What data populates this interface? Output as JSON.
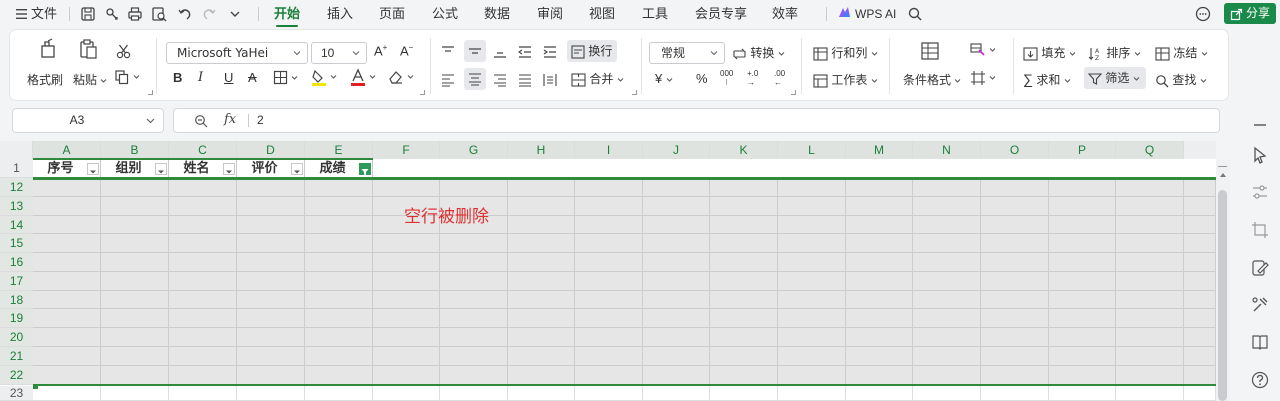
{
  "menubar": {
    "file_label": "文件",
    "tabs": [
      {
        "label": "开始",
        "active": true
      },
      {
        "label": "插入"
      },
      {
        "label": "页面"
      },
      {
        "label": "公式"
      },
      {
        "label": "数据"
      },
      {
        "label": "审阅"
      },
      {
        "label": "视图"
      },
      {
        "label": "工具"
      },
      {
        "label": "会员专享"
      },
      {
        "label": "效率"
      }
    ],
    "ai_label": "WPS AI",
    "share_label": "分享",
    "icons": [
      "hamburger-icon",
      "save-icon",
      "cloud-sync-icon",
      "print-icon",
      "print-preview-icon",
      "undo-icon",
      "redo-icon",
      "more-dropdown-icon",
      "search-icon",
      "message-icon",
      "share-icon"
    ]
  },
  "ribbon": {
    "format_painter": "格式刷",
    "paste": "粘贴",
    "font_name": "Microsoft YaHei",
    "font_size": "10",
    "bold": "B",
    "italic": "I",
    "underline": "U",
    "strike": "A",
    "wrap_text": "换行",
    "merge": "合并",
    "number_format": "常规",
    "convert": "转换",
    "percent": "%",
    "thousands": "000",
    "inc_decimal": "+.0",
    "dec_decimal": ".00",
    "rows_cols": "行和列",
    "worksheet": "工作表",
    "cond_format": "条件格式",
    "fill": "填充",
    "sort": "排序",
    "freeze": "冻结",
    "sum": "求和",
    "filter": "筛选",
    "find": "查找"
  },
  "formula_bar": {
    "cell_ref": "A3",
    "fx": "fx",
    "value": "2"
  },
  "sheet": {
    "columns": [
      "A",
      "B",
      "C",
      "D",
      "E",
      "F",
      "G",
      "H",
      "I",
      "J",
      "K",
      "L",
      "M",
      "N",
      "O",
      "P",
      "Q"
    ],
    "rows": [
      "1",
      "12",
      "13",
      "14",
      "15",
      "16",
      "17",
      "18",
      "19",
      "20",
      "21",
      "22",
      "23"
    ],
    "headers": [
      "序号",
      "组别",
      "姓名",
      "评价",
      "成绩"
    ],
    "annotation": "空行被删除"
  },
  "colors": {
    "accent": "#1a7f37",
    "share_bg": "#1a8a4a",
    "annotation": "#e03131",
    "selection_border": "#2f8a3c"
  }
}
